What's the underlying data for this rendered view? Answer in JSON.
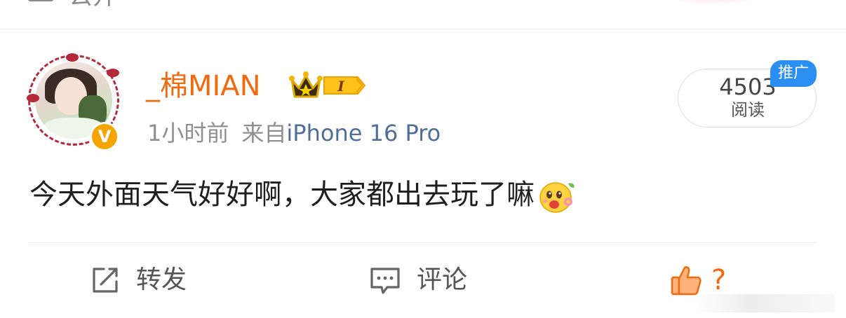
{
  "top_bar": {
    "label": "公开",
    "icon": "lock-icon"
  },
  "post": {
    "username": "_棉MIAN",
    "member_level": "I",
    "time": "1小时前",
    "source_prefix": "来自",
    "device": "iPhone 16 Pro",
    "read_count": "4503",
    "read_label": "阅读",
    "promo_tag": "推广",
    "text": "今天外面天气好好啊，大家都出去玩了嘛",
    "emoji": "smiling-face-with-flower-emoji",
    "verified_badge": "V"
  },
  "actions": {
    "repost_label": "转发",
    "comment_label": "评论",
    "like_label": "?"
  },
  "colors": {
    "accent_orange": "#f06a0f",
    "link_blue": "#4f6f99",
    "promo_blue": "#2b8ff2",
    "verified_gold": "#f5a400"
  }
}
